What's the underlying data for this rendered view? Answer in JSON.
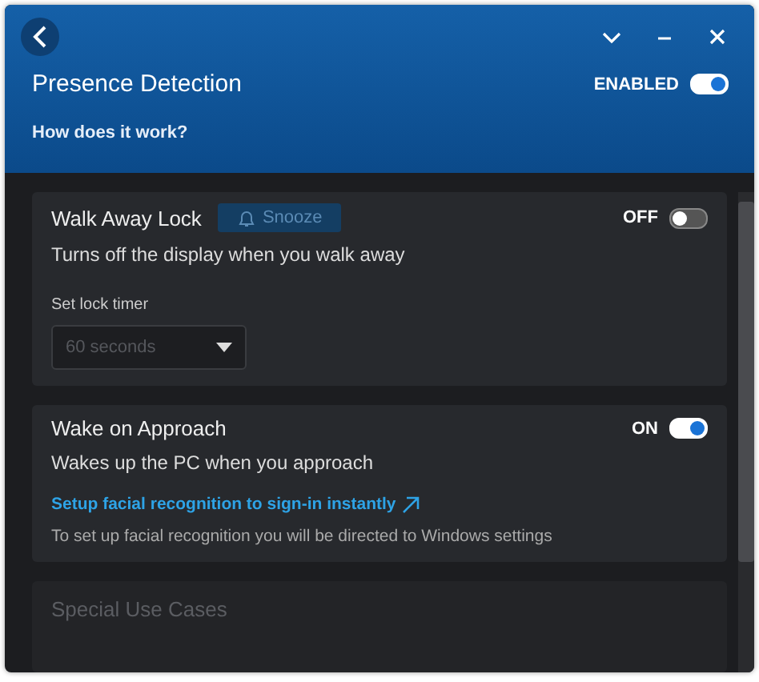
{
  "header": {
    "title": "Presence Detection",
    "status_label": "ENABLED",
    "enabled": true,
    "help_link": "How does it work?"
  },
  "sections": [
    {
      "kind": "lock",
      "title": "Walk Away Lock",
      "snooze_button": "Snooze",
      "state_label": "OFF",
      "on": false,
      "description": "Turns off the display when you walk away",
      "timer_label": "Set lock timer",
      "timer_value": "60 seconds",
      "timer_disabled": true
    },
    {
      "kind": "wake",
      "title": "Wake on Approach",
      "state_label": "ON",
      "on": true,
      "description": "Wakes up the PC when you approach",
      "link": "Setup facial recognition to sign-in instantly",
      "note": "To set up facial recognition you will be directed to Windows settings"
    },
    {
      "kind": "faded",
      "title": "Special Use Cases"
    }
  ]
}
